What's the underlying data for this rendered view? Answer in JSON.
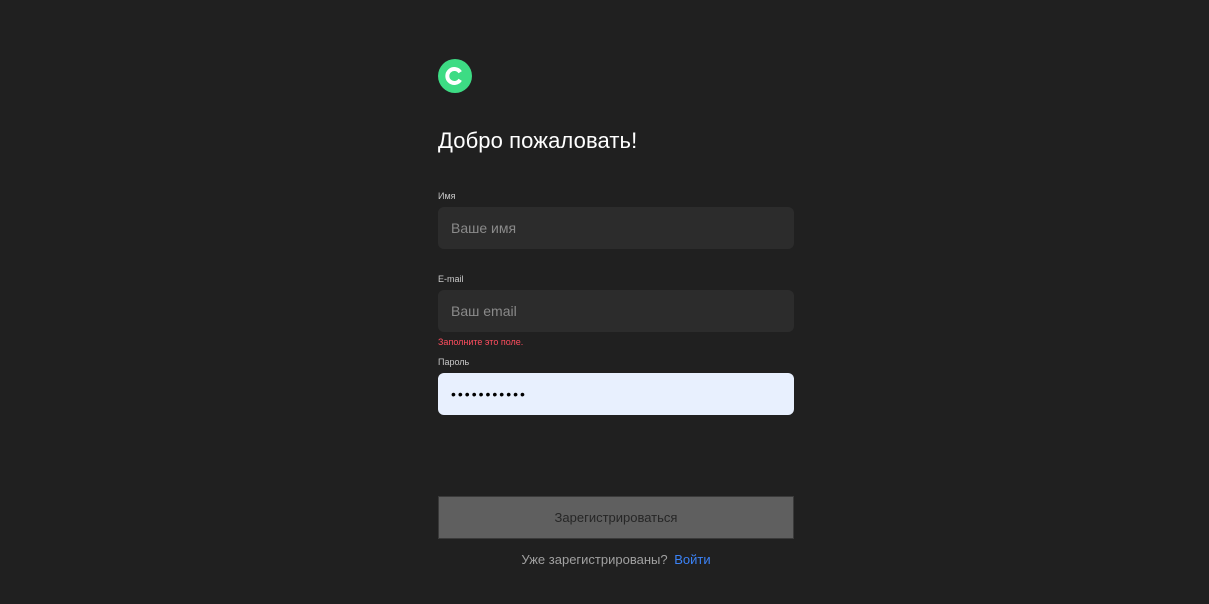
{
  "brand": {
    "logo_icon": "c-logo-icon",
    "logo_color": "#3ddc84"
  },
  "title": "Добро пожаловать!",
  "form": {
    "name": {
      "label": "Имя",
      "placeholder": "Ваше имя",
      "value": ""
    },
    "email": {
      "label": "E-mail",
      "placeholder": "Ваш email",
      "value": "",
      "error": "Заполните это поле."
    },
    "password": {
      "label": "Пароль",
      "value_masked": "•••••••••••"
    },
    "submit_label": "Зарегистрироваться"
  },
  "footer": {
    "text": "Уже зарегистрированы?",
    "link": "Войти"
  },
  "colors": {
    "background": "#202020",
    "input_bg": "#2c2c2c",
    "autofill_bg": "#e8f0fe",
    "error": "#ff4d5e",
    "link": "#3b82f6",
    "button_bg": "#5f5f5f"
  }
}
